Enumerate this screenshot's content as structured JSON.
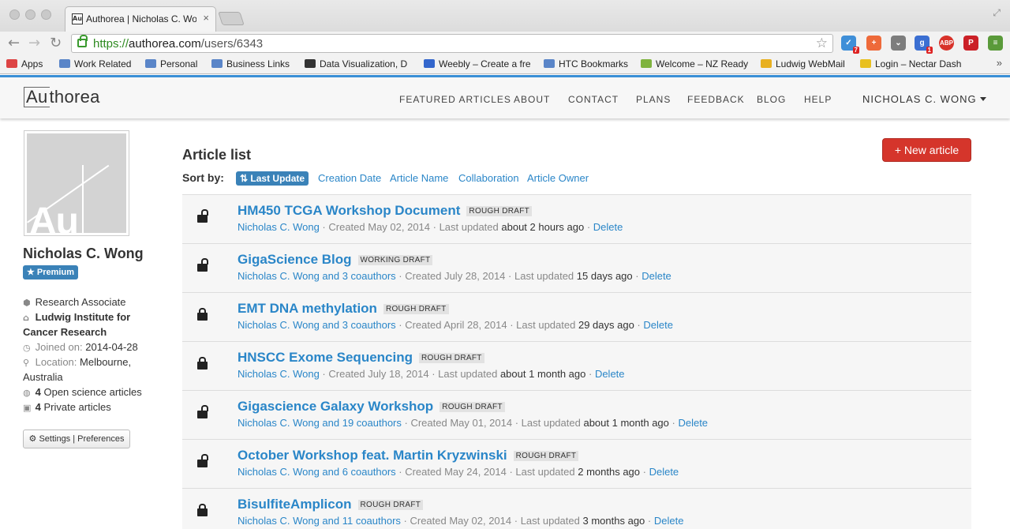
{
  "browser": {
    "tab_title": "Authorea | Nicholas C. Wong",
    "tab_favicon": "Au",
    "tab_close": "×",
    "url_scheme": "https://",
    "url_host": "authorea.com",
    "url_path": "/users/6343",
    "extensions": [
      {
        "name": "checkmark-extension-icon",
        "color": "#3f8fd8",
        "glyph": "✓",
        "badge": "7"
      },
      {
        "name": "plus-extension-icon",
        "color": "#ee6a3a",
        "glyph": "+",
        "badge": ""
      },
      {
        "name": "pocket-extension-icon",
        "color": "#7d7d7d",
        "glyph": "⌄",
        "badge": ""
      },
      {
        "name": "google-extension-icon",
        "color": "#3b6fd2",
        "glyph": "g",
        "badge": "1"
      },
      {
        "name": "adblock-extension-icon",
        "color": "#d8322a",
        "glyph": "ABP",
        "badge": ""
      },
      {
        "name": "pinterest-extension-icon",
        "color": "#cb2027",
        "glyph": "P",
        "badge": ""
      },
      {
        "name": "menu-icon",
        "color": "#5a9a3a",
        "glyph": "≡",
        "badge": ""
      }
    ],
    "bookmarks": [
      {
        "label": "Apps",
        "icon": "apps-grid-icon",
        "color": "#d44"
      },
      {
        "label": "Work Related",
        "icon": "folder-icon",
        "color": "#5a85c8"
      },
      {
        "label": "Personal",
        "icon": "folder-icon",
        "color": "#5a85c8"
      },
      {
        "label": "Business Links",
        "icon": "folder-icon",
        "color": "#5a85c8"
      },
      {
        "label": "Data Visualization, D",
        "icon": "site-icon",
        "color": "#333"
      },
      {
        "label": "Weebly – Create a fre",
        "icon": "site-icon",
        "color": "#3366cc"
      },
      {
        "label": "HTC Bookmarks",
        "icon": "folder-icon",
        "color": "#5a85c8"
      },
      {
        "label": "Welcome – NZ Ready",
        "icon": "site-icon",
        "color": "#7fb33e"
      },
      {
        "label": "Ludwig WebMail",
        "icon": "site-icon",
        "color": "#e8b020"
      },
      {
        "label": "Login – Nectar Dash",
        "icon": "site-icon",
        "color": "#e8c020"
      }
    ],
    "more_bookmarks": "»"
  },
  "header": {
    "logo": "Authorea",
    "logo_boxed": "Au",
    "logo_rest": "thorea",
    "nav": [
      "FEATURED ARTICLES",
      "ABOUT",
      "CONTACT",
      "PLANS",
      "FEEDBACK",
      "BLOG",
      "HELP"
    ],
    "user_menu": "NICHOLAS C. WONG"
  },
  "profile": {
    "avatar_text": "Au",
    "name": "Nicholas C. Wong",
    "badge": "★ Premium",
    "position": "Research Associate",
    "institution_line1": "Ludwig Institute for",
    "institution_line2": "Cancer Research",
    "joined_label": "Joined on:",
    "joined_value": "2014-04-28",
    "location_label": "Location:",
    "location_line1": "Melbourne,",
    "location_line2": "Australia",
    "open_count": "4",
    "open_label": "Open science articles",
    "private_count": "4",
    "private_label": "Private articles",
    "settings_label": "Settings",
    "preferences_label": "Preferences",
    "settings_separator": "|"
  },
  "main": {
    "title": "Article list",
    "new_article": "+ New article",
    "sort_label": "Sort by:",
    "sort_active": "Last Update",
    "sort_options": [
      "Creation Date",
      "Article Name",
      "Collaboration",
      "Article Owner"
    ],
    "articles": [
      {
        "title": "HM450 TCGA Workshop Document",
        "badge": "ROUGH DRAFT",
        "author": "Nicholas C. Wong",
        "created": "Created May 02, 2014",
        "updated_label": "Last updated",
        "updated": "about 2 hours ago",
        "delete": "Delete",
        "lock": "open"
      },
      {
        "title": "GigaScience Blog",
        "badge": "WORKING DRAFT",
        "author": "Nicholas C. Wong and 3 coauthors",
        "created": "Created July 28, 2014",
        "updated_label": "Last updated",
        "updated": "15 days ago",
        "delete": "Delete",
        "lock": "open"
      },
      {
        "title": "EMT DNA methylation",
        "badge": "ROUGH DRAFT",
        "author": "Nicholas C. Wong and 3 coauthors",
        "created": "Created April 28, 2014",
        "updated_label": "Last updated",
        "updated": "29 days ago",
        "delete": "Delete",
        "lock": "closed"
      },
      {
        "title": "HNSCC Exome Sequencing",
        "badge": "ROUGH DRAFT",
        "author": "Nicholas C. Wong",
        "created": "Created July 18, 2014",
        "updated_label": "Last updated",
        "updated": "about 1 month ago",
        "delete": "Delete",
        "lock": "closed"
      },
      {
        "title": "Gigascience Galaxy Workshop",
        "badge": "ROUGH DRAFT",
        "author": "Nicholas C. Wong and 19 coauthors",
        "created": "Created May 01, 2014",
        "updated_label": "Last updated",
        "updated": "about 1 month ago",
        "delete": "Delete",
        "lock": "open"
      },
      {
        "title": "October Workshop feat. Martin Kryzwinski",
        "badge": "ROUGH DRAFT",
        "author": "Nicholas C. Wong and 6 coauthors",
        "created": "Created May 24, 2014",
        "updated_label": "Last updated",
        "updated": "2 months ago",
        "delete": "Delete",
        "lock": "open"
      },
      {
        "title": "BisulfiteAmplicon",
        "badge": "ROUGH DRAFT",
        "author": "Nicholas C. Wong and 11 coauthors",
        "created": "Created May 02, 2014",
        "updated_label": "Last updated",
        "updated": "3 months ago",
        "delete": "Delete",
        "lock": "closed"
      }
    ]
  }
}
